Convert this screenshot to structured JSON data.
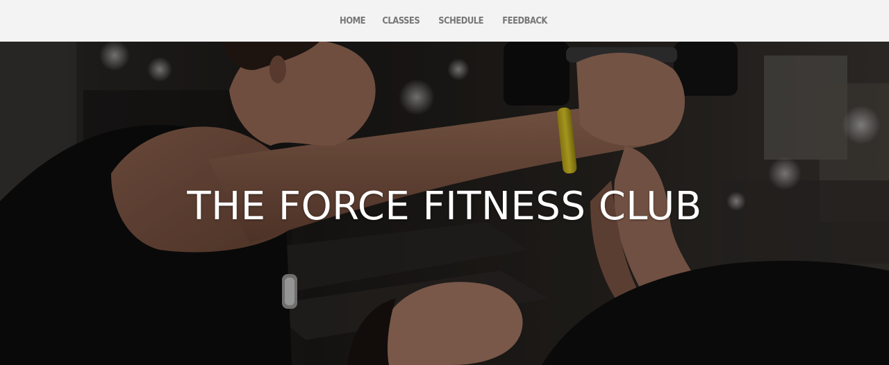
{
  "nav": {
    "items": [
      {
        "label": "HOME"
      },
      {
        "label": "CLASSES"
      },
      {
        "label": "SCHEDULE"
      },
      {
        "label": "FEEDBACK"
      }
    ]
  },
  "hero": {
    "title": "THE FORCE FITNESS CLUB",
    "image_description_icon": "gym-trainer-photo"
  },
  "colors": {
    "nav_background": "#f3f3f3",
    "nav_text": "#777777",
    "hero_title": "#ffffff",
    "wristband": "#d6c21c"
  }
}
